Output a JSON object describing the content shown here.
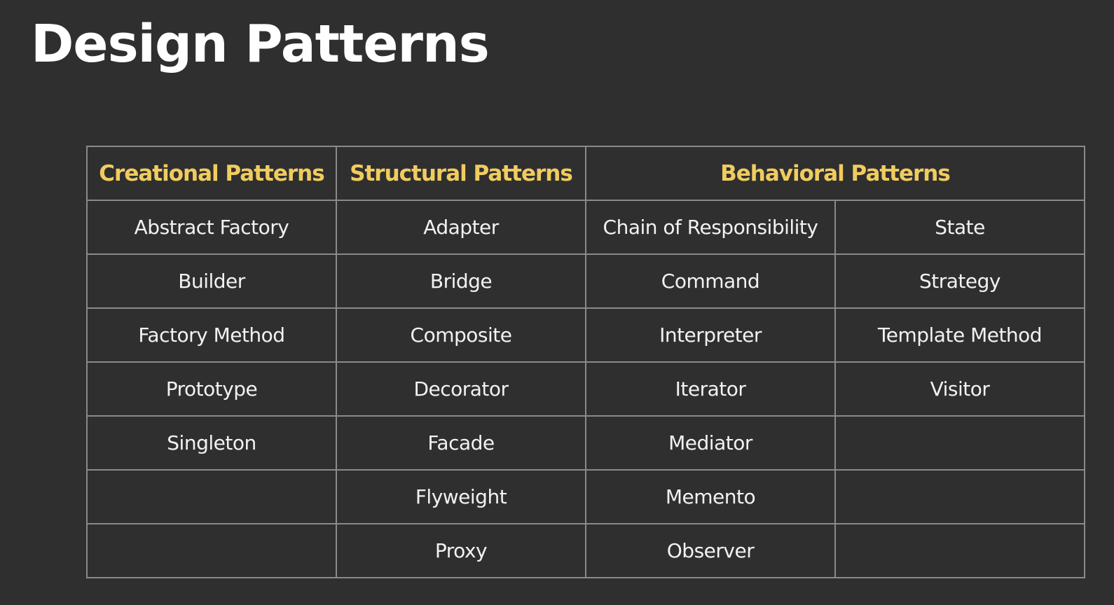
{
  "title": "Design Patterns",
  "table": {
    "headers": {
      "creational": "Creational Patterns",
      "structural": "Structural Patterns",
      "behavioral": "Behavioral Patterns"
    },
    "rows": [
      [
        "Abstract Factory",
        "Adapter",
        "Chain of Responsibility",
        "State"
      ],
      [
        "Builder",
        "Bridge",
        "Command",
        "Strategy"
      ],
      [
        "Factory Method",
        "Composite",
        "Interpreter",
        "Template Method"
      ],
      [
        "Prototype",
        "Decorator",
        "Iterator",
        "Visitor"
      ],
      [
        "Singleton",
        "Facade",
        "Mediator",
        ""
      ],
      [
        "",
        "Flyweight",
        "Memento",
        ""
      ],
      [
        "",
        "Proxy",
        "Observer",
        ""
      ]
    ]
  },
  "colors": {
    "background": "#2f2f2f",
    "header_text": "#f0cc5f",
    "cell_text": "#f2f2f2",
    "grid_lines": "#8a8a8a"
  }
}
